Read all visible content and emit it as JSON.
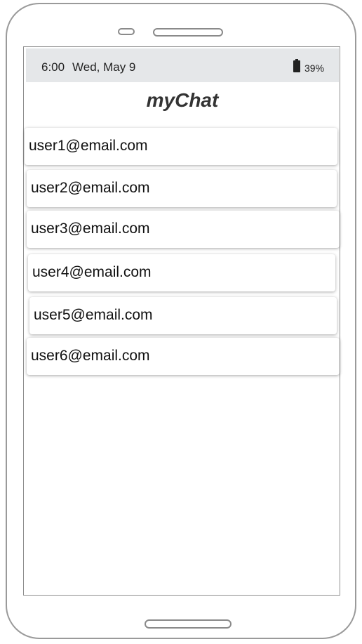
{
  "status_bar": {
    "time": "6:00",
    "date": "Wed, May 9",
    "battery_percent": "39%",
    "battery_icon": "battery-icon"
  },
  "app": {
    "title": "myChat"
  },
  "users": [
    "user1@email.com",
    "user2@email.com",
    "user3@email.com",
    "user4@email.com",
    "user5@email.com",
    "user6@email.com"
  ],
  "colors": {
    "status_bar_bg": "#e5e7e9",
    "title_text": "#333333",
    "frame": "#9a9a9a"
  }
}
